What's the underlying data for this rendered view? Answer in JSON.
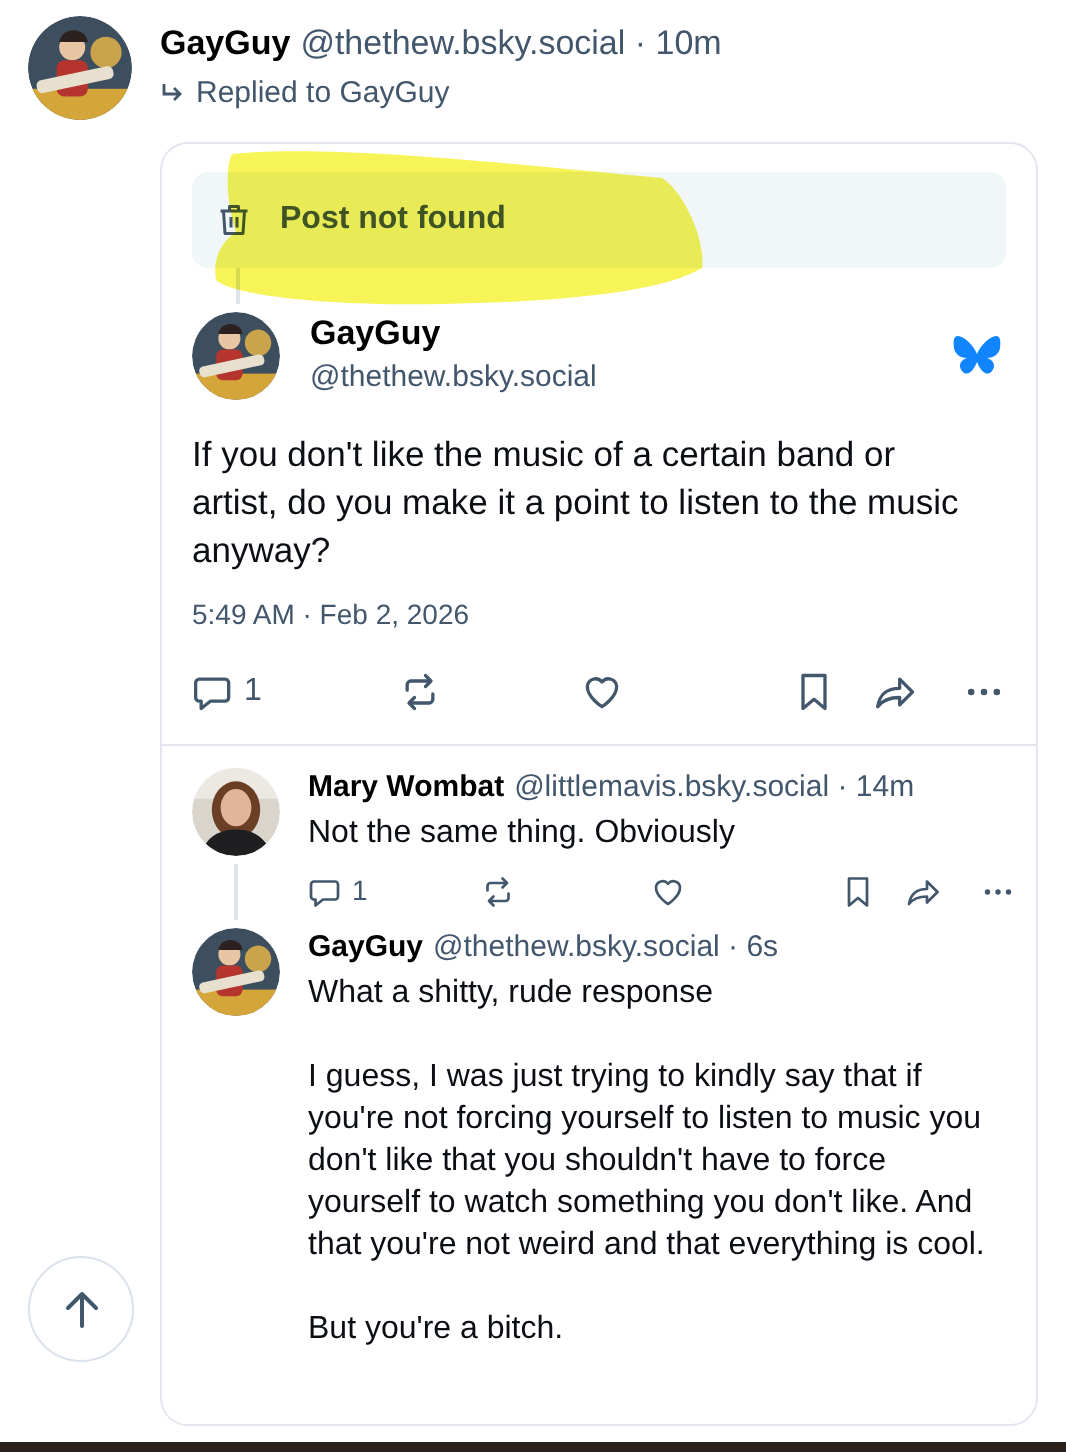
{
  "post": {
    "display_name": "GayGuy",
    "byline": "@thethew.bsky.social · 10m",
    "reply_to": "Replied to GayGuy",
    "thread": {
      "missing_parent": {
        "text": "Post not found"
      },
      "main": {
        "display_name": "GayGuy",
        "handle": "@thethew.bsky.social",
        "text": "If you don't like the music of a certain band or artist, do you make it a point to listen to the music anyway?",
        "timestamp": "5:49 AM · Feb 2, 2026",
        "actions": [
          {
            "kind": "reply",
            "count": "1"
          },
          {
            "kind": "repost"
          },
          {
            "kind": "like"
          },
          {
            "kind": "bookmark"
          },
          {
            "kind": "share"
          },
          {
            "kind": "more"
          }
        ]
      },
      "replies": [
        {
          "display_name": "Mary Wombat",
          "byline": "@littlemavis.bsky.social · 14m",
          "paragraphs": [
            "Not the same thing. Obviously"
          ],
          "actions": [
            {
              "kind": "reply",
              "count": "1"
            },
            {
              "kind": "repost"
            },
            {
              "kind": "like"
            },
            {
              "kind": "bookmark"
            },
            {
              "kind": "share"
            },
            {
              "kind": "more"
            }
          ]
        },
        {
          "display_name": "GayGuy",
          "byline": "@thethew.bsky.social · 6s",
          "paragraphs": [
            "What a shitty, rude response",
            "I guess, I was just trying to kindly say that if you're not forcing yourself to listen to music you don't like that you shouldn't have to force yourself to watch something you don't like. And that you're not weird and that everything is cool.",
            "But you're a bitch."
          ]
        }
      ]
    }
  }
}
